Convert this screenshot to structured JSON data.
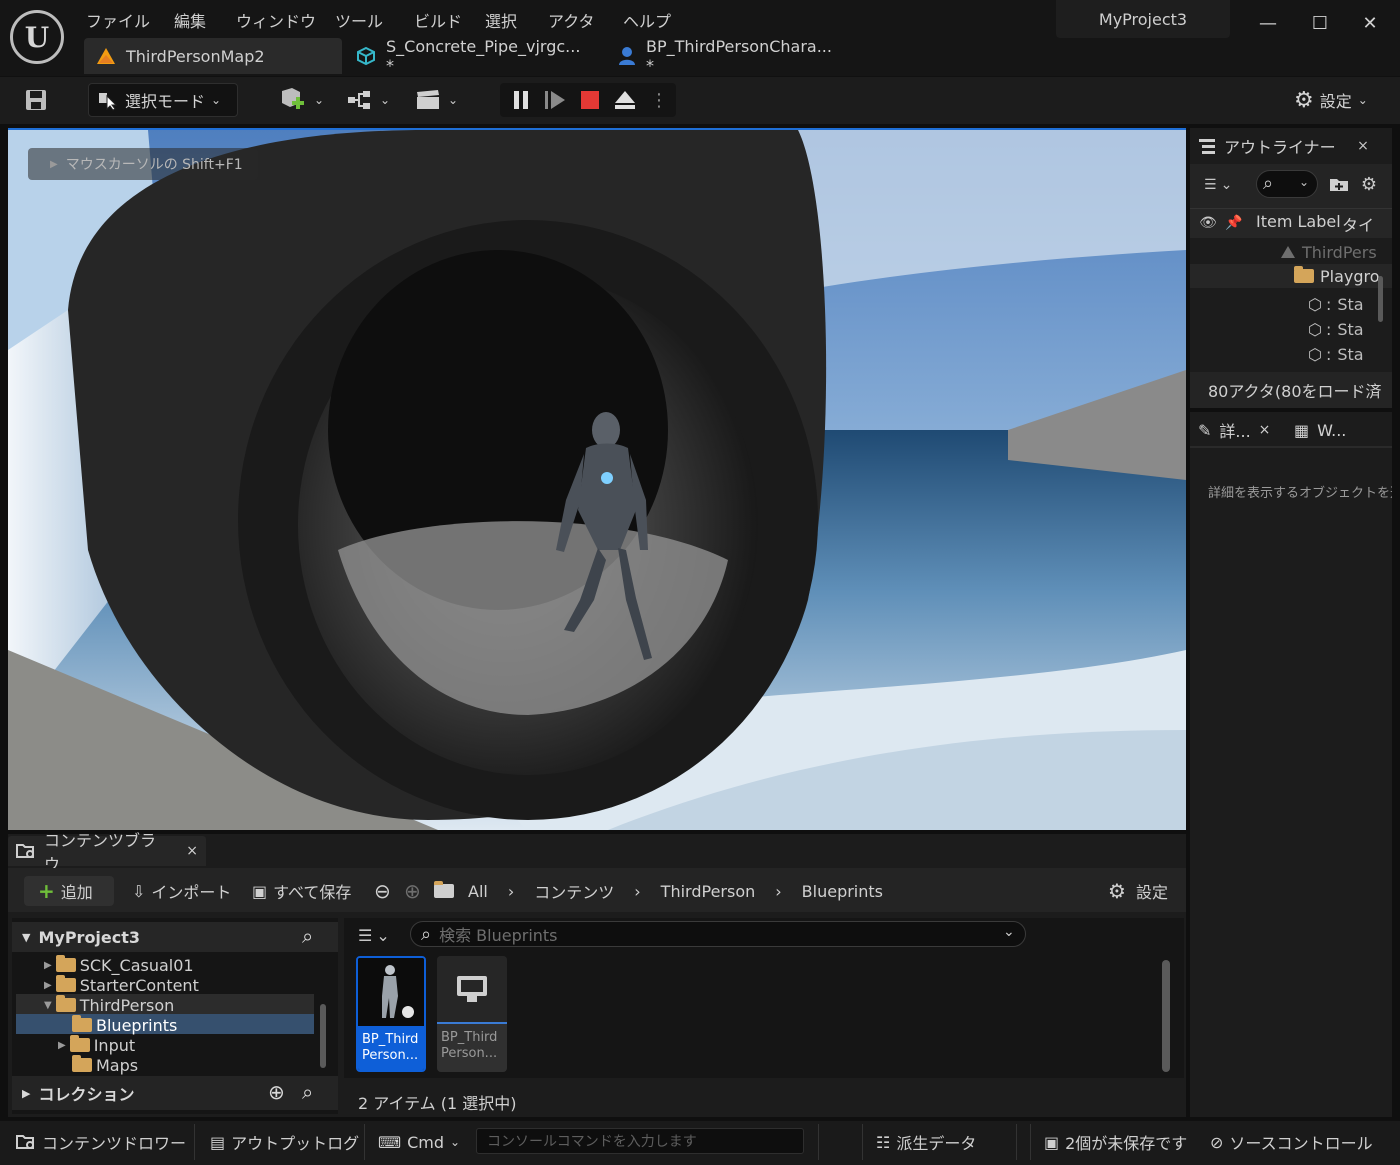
{
  "app": {
    "logo_icon": "unreal-engine-logo",
    "menu": [
      "ファイル",
      "編集",
      "ウィンドウ",
      "ツール",
      "ビルド",
      "選択",
      "アクタ",
      "ヘルプ"
    ],
    "project_name": "MyProject3",
    "doc_tabs": [
      {
        "label": "ThirdPersonMap2",
        "icon": "level-icon"
      },
      {
        "label": "S_Concrete_Pipe_vjrgc... *",
        "icon": "static-mesh-icon"
      },
      {
        "label": "BP_ThirdPersonChara... *",
        "icon": "blueprint-icon"
      }
    ],
    "window_controls": {
      "minimize": "—",
      "maximize": "☐",
      "close": "✕"
    }
  },
  "toolbar": {
    "mode_label": "選択モード",
    "settings_label": "設定"
  },
  "viewport": {
    "hint": "マウスカーソルの Shift+F1"
  },
  "outliner": {
    "title": "アウトライナー",
    "close": "×",
    "col_item_label": "Item Label",
    "col_type": "タイ",
    "rows": [
      {
        "label": "ThirdPers"
      },
      {
        "label": "Playgro"
      },
      {
        "label": "Sta"
      },
      {
        "label": "Sta"
      },
      {
        "label": "Sta"
      }
    ],
    "footer": "80アクタ(80をロード済"
  },
  "details": {
    "tab_details": "詳...",
    "tab_close": "×",
    "tab_world": "W...",
    "empty_text": "詳細を表示するオブジェクトを選"
  },
  "content_browser": {
    "tab_label": "コンテンツブラウ...",
    "tab_close": "×",
    "add_label": "追加",
    "import_label": "インポート",
    "save_all_label": "すべて保存",
    "breadcrumb": [
      "All",
      "コンテンツ",
      "ThirdPerson",
      "Blueprints"
    ],
    "settings_label": "設定",
    "tree_root": "MyProject3",
    "tree": [
      {
        "label": "SCK_Casual01",
        "depth": 1,
        "expander": "▶"
      },
      {
        "label": "StarterContent",
        "depth": 1,
        "expander": "▶"
      },
      {
        "label": "ThirdPerson",
        "depth": 1,
        "expander": "▼"
      },
      {
        "label": "Blueprints",
        "depth": 2,
        "expander": ""
      },
      {
        "label": "Input",
        "depth": 2,
        "expander": "▶"
      },
      {
        "label": "Maps",
        "depth": 2,
        "expander": ""
      }
    ],
    "collections_label": "コレクション",
    "search_placeholder": "検索 Blueprints",
    "assets": [
      {
        "label": "BP_Third Person...",
        "selected": true
      },
      {
        "label": "BP_Third Person...",
        "selected": false
      }
    ],
    "item_count": "2 アイテム (1 選択中)"
  },
  "statusbar": {
    "content_drawer": "コンテンツドロワー",
    "output_log": "アウトプットログ",
    "cmd": "Cmd",
    "console_placeholder": "コンソールコマンドを入力します",
    "derived_data": "派生データ",
    "unsaved": "2個が未保存です",
    "source_control": "ソースコントロール"
  },
  "colors": {
    "accent_blue": "#1f6fd6",
    "selection_blue": "#0e5fd8",
    "folder": "#d4a55a",
    "stop_red": "#e53935",
    "add_green": "#6fbf3a"
  }
}
